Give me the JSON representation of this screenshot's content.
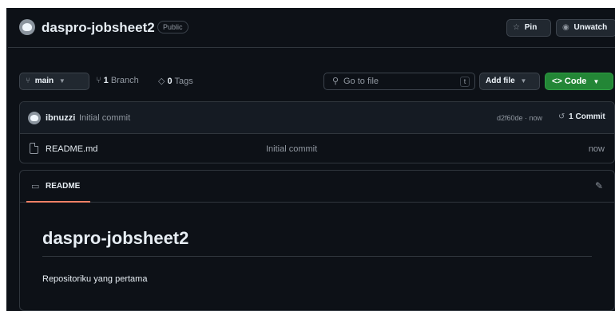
{
  "repo": {
    "name": "daspro-jobsheet2",
    "visibility": "Public"
  },
  "actions": {
    "pin_label": "Pin",
    "unwatch_label": "Unwatch"
  },
  "branch_bar": {
    "branch": "main",
    "branch_count": "1",
    "branch_text": "Branch",
    "tag_count": "0",
    "tag_text": "Tags",
    "search_placeholder": "Go to file",
    "search_shortcut": "t",
    "add_file_label": "Add file",
    "code_label": "Code"
  },
  "latest_commit": {
    "author": "ibnuzzi",
    "message": "Initial commit",
    "hash_time": "d2f60de · now",
    "commit_count": "1 Commit"
  },
  "files": [
    {
      "name": "README.md",
      "message": "Initial commit",
      "time": "now"
    }
  ],
  "readme": {
    "tab_label": "README",
    "heading": "daspro-jobsheet2",
    "paragraph": "Repositoriku yang pertama"
  }
}
